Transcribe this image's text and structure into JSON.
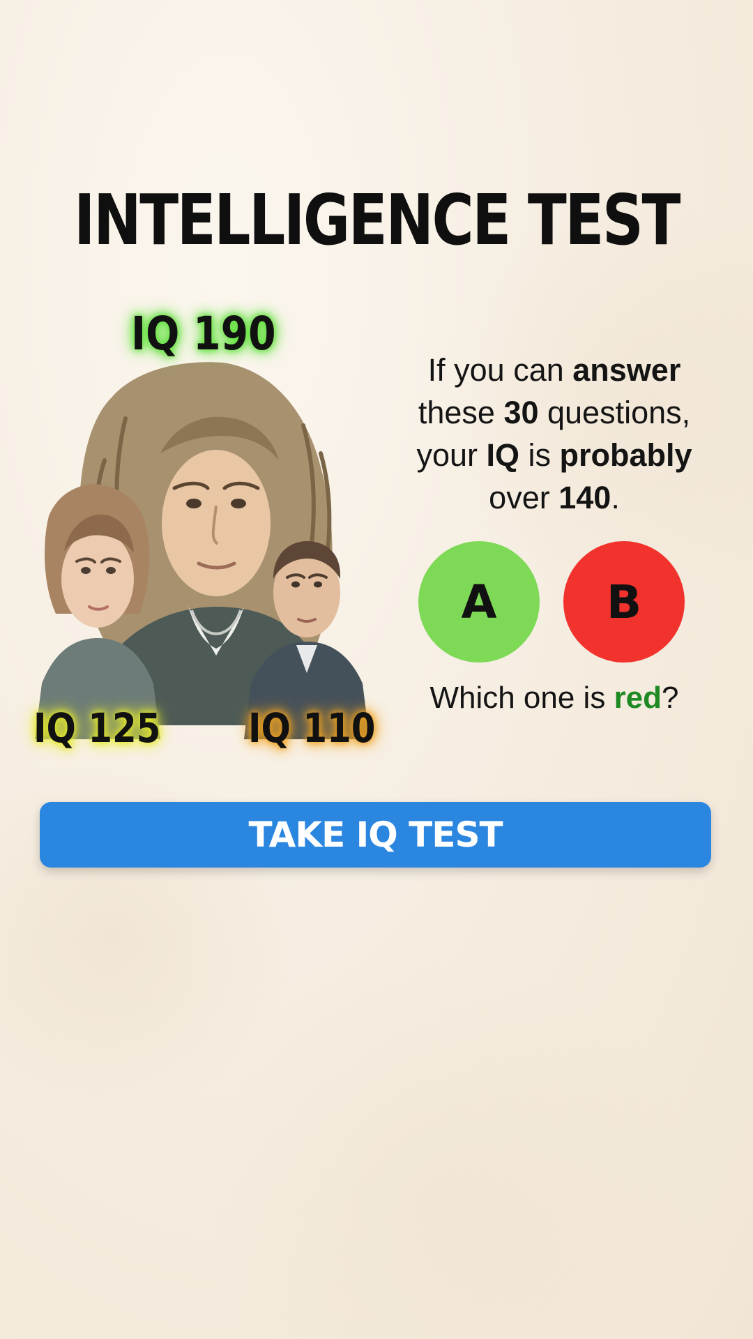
{
  "title": "INTELLIGENCE TEST",
  "portraits": {
    "top": {
      "label": "IQ 190"
    },
    "left": {
      "label": "IQ 125"
    },
    "right": {
      "label": "IQ 110"
    }
  },
  "blurb": {
    "line1_a": "If you can ",
    "line1_b": "answer",
    "line2_a": "these ",
    "line2_b": "30",
    "line2_c": " questions,",
    "line3_a": "your ",
    "line3_b": "IQ",
    "line3_c": " is ",
    "line3_d": "probably",
    "line4_a": "over ",
    "line4_b": "140",
    "line4_c": "."
  },
  "choices": [
    {
      "label": "A",
      "color": "#7ed957"
    },
    {
      "label": "B",
      "color": "#f2322d"
    }
  ],
  "question": {
    "prefix": "Which one is ",
    "keyword": "red",
    "suffix": "?",
    "keyword_color": "#1f8a24"
  },
  "cta": {
    "label": "TAKE IQ TEST",
    "color": "#2b86e0"
  },
  "icons": [
    "portrait-top-icon",
    "portrait-left-icon",
    "portrait-right-icon"
  ]
}
